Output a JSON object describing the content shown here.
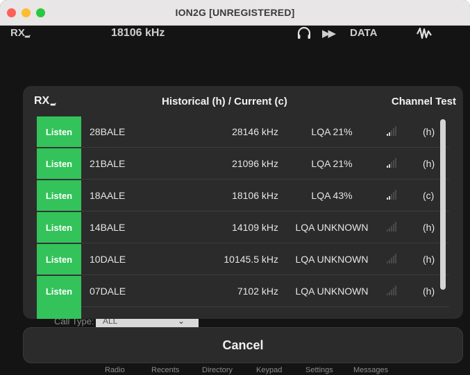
{
  "window": {
    "title": "ION2G [UNREGISTERED]"
  },
  "topbar": {
    "rx_label": "RX",
    "frequency": "18106 kHz",
    "mode": "DATA"
  },
  "panel": {
    "rx_label": "RX",
    "title": "Historical (h) / Current (c)",
    "right_title": "Channel Test",
    "listen_label": "Listen",
    "rows": [
      {
        "name": "28BALE",
        "freq": "28146 kHz",
        "lqa": "LQA 21%",
        "signal_bars": 2,
        "state": "(h)"
      },
      {
        "name": "21BALE",
        "freq": "21096 kHz",
        "lqa": "LQA 21%",
        "signal_bars": 2,
        "state": "(h)"
      },
      {
        "name": "18AALE",
        "freq": "18106 kHz",
        "lqa": "LQA 43%",
        "signal_bars": 2,
        "state": "(c)"
      },
      {
        "name": "14BALE",
        "freq": "14109 kHz",
        "lqa": "LQA UNKNOWN",
        "signal_bars": 0,
        "state": "(h)"
      },
      {
        "name": "10DALE",
        "freq": "10145.5 kHz",
        "lqa": "LQA UNKNOWN",
        "signal_bars": 0,
        "state": "(h)"
      },
      {
        "name": "07DALE",
        "freq": "7102 kHz",
        "lqa": "LQA UNKNOWN",
        "signal_bars": 0,
        "state": "(h)"
      }
    ]
  },
  "behind": {
    "call_type_label": "Call Type:",
    "call_type_value": "ALL"
  },
  "cancel_label": "Cancel",
  "tabs": [
    "Radio",
    "Recents",
    "Directory",
    "Keypad",
    "Settings",
    "Messages"
  ],
  "colors": {
    "listen_green": "#33c35a",
    "panel_bg": "#2b2b2b",
    "app_bg": "#141414"
  },
  "icons": [
    "headset-icon",
    "fast-forward-icon",
    "waveform-icon",
    "signal-bars-icon"
  ]
}
